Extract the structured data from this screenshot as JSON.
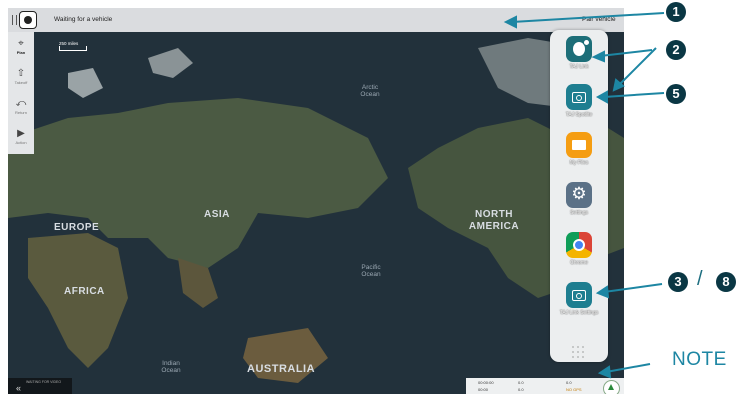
{
  "topbar": {
    "status_text": "Waiting for a vehicle",
    "pair_text": "Pair vehicle"
  },
  "tools": [
    {
      "label": "Plan",
      "icon": "route-pin-icon"
    },
    {
      "label": "Takeoff",
      "icon": "takeoff-icon"
    },
    {
      "label": "Return",
      "icon": "return-icon"
    },
    {
      "label": "Action",
      "icon": "play-icon"
    }
  ],
  "map": {
    "scale_text": "250 miles",
    "continents": [
      "EUROPE",
      "ASIA",
      "NORTH AMERICA",
      "AFRICA",
      "AUSTRALIA"
    ],
    "oceans": [
      "Arctic Ocean",
      "Pacific Ocean",
      "Indian Ocean"
    ]
  },
  "video": {
    "text": "WAITING FOR VIDEO"
  },
  "info": {
    "t1": "00:00:00",
    "t2": "00:00",
    "v1": "0.0",
    "v2": "0.0",
    "v3": "0.0",
    "nogps": "NO GPS"
  },
  "apps": [
    {
      "name": "TAJ Link",
      "icon": "taj-link-icon"
    },
    {
      "name": "TAJ Spotlite",
      "icon": "camera-icon"
    },
    {
      "name": "My Files",
      "icon": "folder-icon"
    },
    {
      "name": "Settings",
      "icon": "gear-icon"
    },
    {
      "name": "Chrome",
      "icon": "chrome-icon"
    },
    {
      "name": "TAJ Link Settings",
      "icon": "camera-icon"
    }
  ],
  "callouts": {
    "b1": "1",
    "b2": "2",
    "b5": "5",
    "b3": "3",
    "slash": "/",
    "b8": "8",
    "note": "NOTE"
  }
}
